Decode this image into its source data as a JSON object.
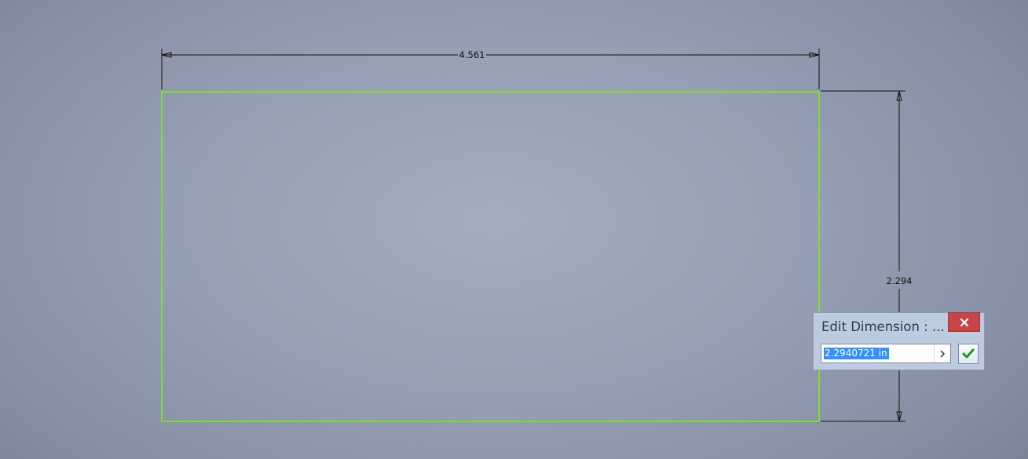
{
  "sketch": {
    "horizontal_dimension": "4.561",
    "vertical_dimension": "2.294",
    "profile_color": "#7dde30",
    "dimension_line_color": "#111111"
  },
  "edit_dimension_dialog": {
    "title": "Edit Dimension : ...",
    "value": "2.2940721 in",
    "close_icon": "close-x-icon",
    "expand_icon": "chevron-right-icon",
    "accept_icon": "checkmark-icon",
    "close_button_color": "#c94545",
    "accept_check_color": "#1a9a1a"
  }
}
